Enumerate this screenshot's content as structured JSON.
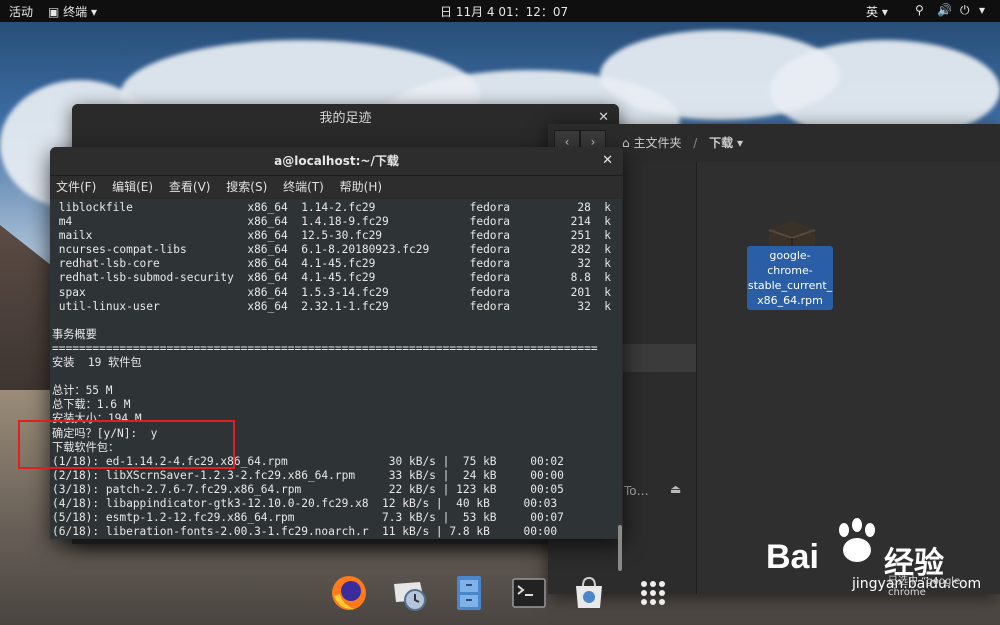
{
  "topbar": {
    "activities": "活动",
    "app_menu": "终端",
    "clock": "日 11月 4 01：12：07",
    "input_method": "英"
  },
  "back_window": {
    "title": "我的足迹"
  },
  "files_window": {
    "home": "主文件夹",
    "path_current": "下载",
    "file_name": "google-chrome-stable_current_x86_64.rpm",
    "file_name_lines": [
      "google-chrome-",
      "stable_current_",
      "x86_64.rpm"
    ],
    "sidebar_partial": "To…",
    "status": "已选中 “google-chrome"
  },
  "terminal": {
    "title": "a@localhost:~/下载",
    "menu": [
      "文件(F)",
      "编辑(E)",
      "查看(V)",
      "搜索(S)",
      "终端(T)",
      "帮助(H)"
    ],
    "output": " liblockfile                 x86_64  1.14-2.fc29              fedora          28  k\n m4                          x86_64  1.4.18-9.fc29            fedora         214  k\n mailx                       x86_64  12.5-30.fc29             fedora         251  k\n ncurses-compat-libs         x86_64  6.1-8.20180923.fc29      fedora         282  k\n redhat-lsb-core             x86_64  4.1-45.fc29              fedora          32  k\n redhat-lsb-submod-security  x86_64  4.1-45.fc29              fedora         8.8  k\n spax                        x86_64  1.5.3-14.fc29            fedora         201  k\n util-linux-user             x86_64  2.32.1-1.fc29            fedora          32  k\n\n事务概要\n=================================================================================\n安装  19 软件包\n\n总计：55 M\n总下载：1.6 M\n安装大小：194 M\n确定吗？[y/N]:  y\n下载软件包：\n(1/18): ed-1.14.2-4.fc29.x86_64.rpm               30 kB/s |  75 kB     00:02\n(2/18): libXScrnSaver-1.2.3-2.fc29.x86_64.rpm     33 kB/s |  24 kB     00:00\n(3/18): patch-2.7.6-7.fc29.x86_64.rpm             22 kB/s | 123 kB     00:05\n(4/18): libappindicator-gtk3-12.10.0-20.fc29.x8  12 kB/s |  40 kB     00:03\n(5/18): esmtp-1.2-12.fc29.x86_64.rpm             7.3 kB/s |  53 kB     00:07\n(6/18): liberation-fonts-2.00.3-1.fc29.noarch.r  11 kB/s | 7.8 kB     00:00"
  },
  "watermark": {
    "brand": "Bai",
    "brand2": "经验",
    "url": "jingyan.baidu.com"
  },
  "icons": {
    "dock": [
      "firefox-icon",
      "mail-icon",
      "files-icon",
      "terminal-icon",
      "software-icon",
      "app-grid-icon"
    ]
  },
  "colors": {
    "accent": "#2a5fa8",
    "highlight": "#e02020"
  }
}
